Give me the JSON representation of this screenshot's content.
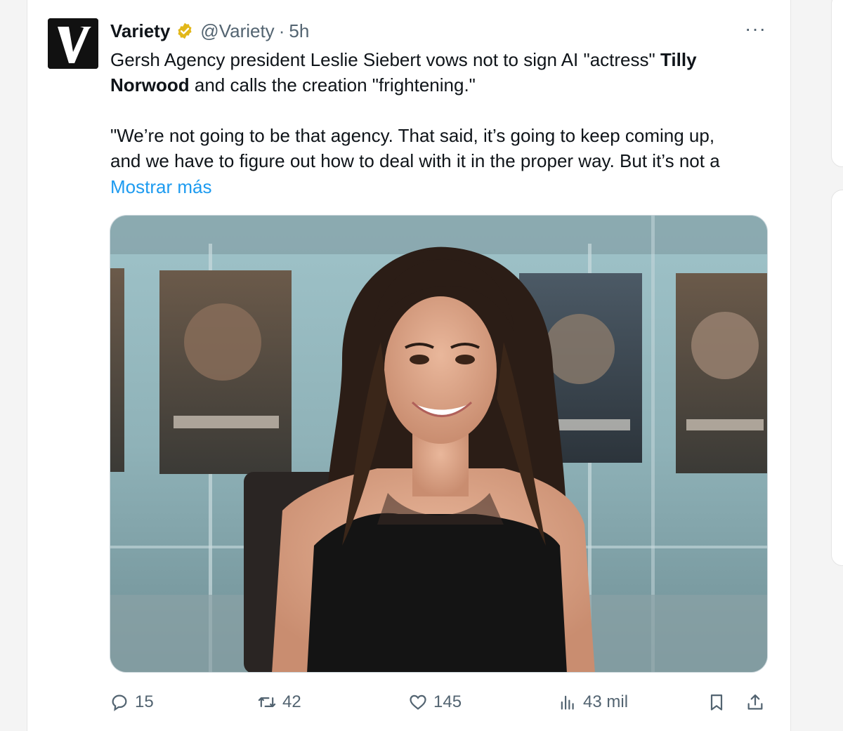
{
  "tweet": {
    "author_name": "Variety",
    "author_handle": "@Variety",
    "separator": "·",
    "time": "5h",
    "text_line1_pre": "Gersh Agency president Leslie Siebert vows not to sign AI \"actress\" ",
    "text_line1_bold": "Tilly",
    "text_line2_bold": "Norwood",
    "text_line2_post": " and calls the creation \"frightening.\"",
    "text_line3": "\"We’re not going to be that agency. That said, it’s going to keep coming up,",
    "text_line4": "and we have to figure out how to deal with it in the proper way. But it’s not a",
    "show_more": "Mostrar más",
    "more_menu": "···"
  },
  "actions": {
    "replies": "15",
    "retweets": "42",
    "likes": "145",
    "views": "43 mil"
  },
  "icons": {
    "verified": "verified-badge-icon",
    "reply": "reply-icon",
    "retweet": "retweet-icon",
    "like": "heart-icon",
    "views": "views-icon",
    "bookmark": "bookmark-icon",
    "share": "share-icon"
  },
  "colors": {
    "accent": "#1d9bf0",
    "muted": "#536471",
    "verified_gold": "#e2b719"
  }
}
